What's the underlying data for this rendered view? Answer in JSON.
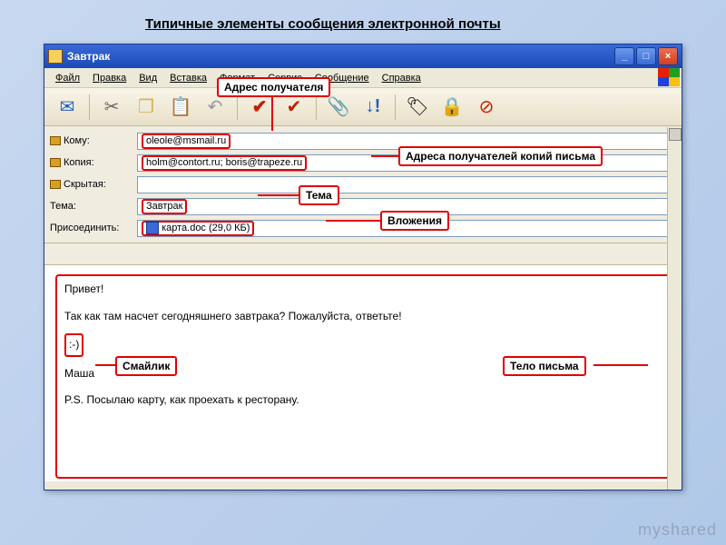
{
  "slide_title": "Типичные элементы сообщения электронной почты",
  "window": {
    "title": "Завтрак"
  },
  "menu": [
    "Файл",
    "Правка",
    "Вид",
    "Вставка",
    "Формат",
    "Сервис",
    "Сообщение",
    "Справка"
  ],
  "fields": {
    "to_label": "Кому:",
    "to_value": "oleole@msmail.ru",
    "cc_label": "Копия:",
    "cc_value": "holm@contort.ru; boris@trapeze.ru",
    "bcc_label": "Скрытая:",
    "bcc_value": "",
    "subject_label": "Тема:",
    "subject_value": "Завтрак",
    "attach_label": "Присоединить:",
    "attach_value": "карта.doc (29,0 КБ)"
  },
  "body": {
    "greeting": "Привет!",
    "line1": "Так как там насчет сегодняшнего завтрака? Пожалуйста, ответьте!",
    "smiley": ":-)",
    "name": "Маша",
    "ps": "P.S. Посылаю карту, как проехать к ресторану."
  },
  "annotations": {
    "recipient": "Адрес получателя",
    "cc": "Адреса получателей копий письма",
    "subject": "Тема",
    "attachment": "Вложения",
    "smiley": "Смайлик",
    "body": "Тело письма"
  },
  "watermark": "myshared"
}
